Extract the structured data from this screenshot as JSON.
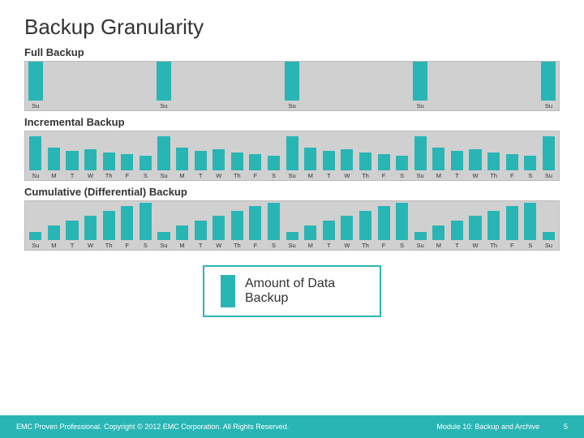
{
  "page": {
    "title": "Backup Granularity"
  },
  "full_backup": {
    "label": "Full Backup",
    "day_labels": [
      "Su",
      "",
      "",
      "",
      "",
      "",
      "",
      "Su",
      "",
      "",
      "",
      "",
      "",
      "",
      "Su",
      "",
      "",
      "",
      "",
      "",
      "",
      "Su",
      "",
      "",
      "",
      "",
      "",
      "",
      "Su"
    ]
  },
  "incremental_backup": {
    "label": "Incremental Backup",
    "day_labels": [
      "Su",
      "M",
      "T",
      "W",
      "Th",
      "F",
      "S",
      "Su",
      "M",
      "T",
      "W",
      "Th",
      "F",
      "S",
      "Su",
      "M",
      "T",
      "W",
      "Th",
      "F",
      "S",
      "Su",
      "M",
      "T",
      "W",
      "Th",
      "F",
      "S",
      "Su"
    ]
  },
  "cumulative_backup": {
    "label": "Cumulative (Differential) Backup",
    "day_labels": [
      "Su",
      "M",
      "T",
      "W",
      "Th",
      "F",
      "S",
      "Su",
      "M",
      "T",
      "W",
      "Th",
      "F",
      "S",
      "Su",
      "M",
      "T",
      "W",
      "Th",
      "F",
      "S",
      "Su",
      "M",
      "T",
      "W",
      "Th",
      "F",
      "S",
      "Su"
    ]
  },
  "legend": {
    "text": "Amount of Data Backup"
  },
  "footer": {
    "left": "EMC Proven Professional. Copyright © 2012 EMC Corporation. All Rights Reserved.",
    "module": "Module 10: Backup and Archive",
    "page": "5"
  }
}
